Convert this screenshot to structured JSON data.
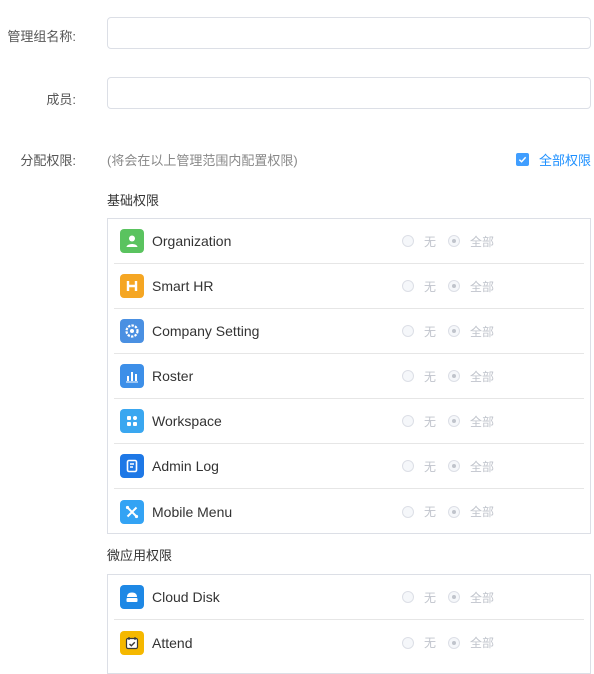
{
  "form": {
    "group_name_label": "管理组名称:",
    "group_name_value": "",
    "members_label": "成员:",
    "members_value": "",
    "permissions_label": "分配权限:",
    "permissions_hint": "(将会在以上管理范围内配置权限)",
    "select_all_label": "全部权限"
  },
  "basic": {
    "title": "基础权限",
    "items": [
      {
        "name": "Organization",
        "icon": "person-icon",
        "color": "#5ac35f"
      },
      {
        "name": "Smart HR",
        "icon": "hr-icon",
        "color": "#f5a623"
      },
      {
        "name": "Company Setting",
        "icon": "gear-icon",
        "color": "#4a90e2"
      },
      {
        "name": "Roster",
        "icon": "bar-chart-icon",
        "color": "#3d8fe8"
      },
      {
        "name": "Workspace",
        "icon": "grid-icon",
        "color": "#3aa7f0"
      },
      {
        "name": "Admin Log",
        "icon": "document-icon",
        "color": "#1e78e6"
      },
      {
        "name": "Mobile Menu",
        "icon": "tools-icon",
        "color": "#33a3f4"
      }
    ]
  },
  "micro": {
    "title": "微应用权限",
    "items": [
      {
        "name": "Cloud Disk",
        "icon": "cloud-disk-icon",
        "color": "#1e88e5"
      },
      {
        "name": "Attend",
        "icon": "calendar-check-icon",
        "color": "#f5b800"
      }
    ]
  },
  "options": {
    "none": "无",
    "all": "全部"
  }
}
